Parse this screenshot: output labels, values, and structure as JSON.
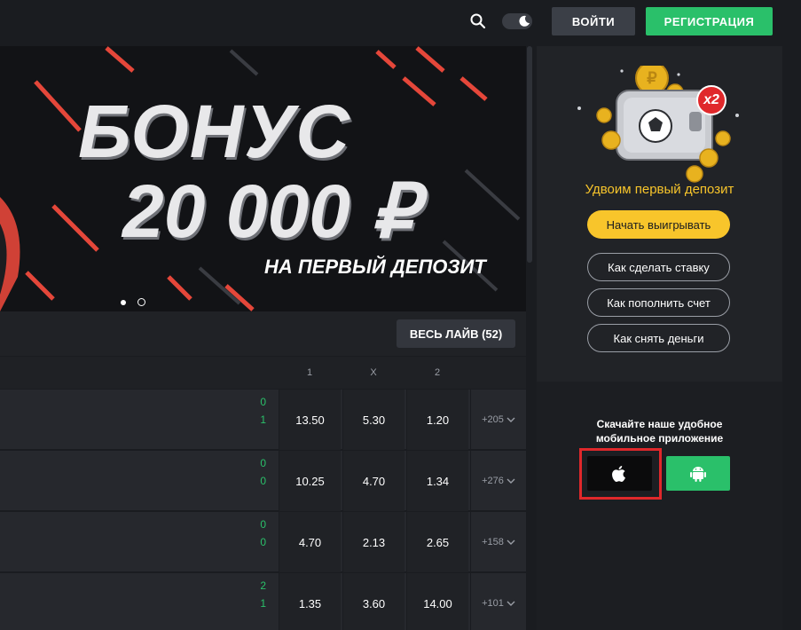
{
  "header": {
    "login_label": "ВОЙТИ",
    "register_label": "РЕГИСТРАЦИЯ"
  },
  "banner": {
    "title": "БОНУС",
    "amount": "20 000 ₽",
    "subtitle": "НА ПЕРВЫЙ ДЕПОЗИТ"
  },
  "live": {
    "all_live_label": "ВЕСЬ ЛАЙВ (52)"
  },
  "table": {
    "headers": [
      "1",
      "X",
      "2"
    ],
    "rows": [
      {
        "score_top": "0",
        "score_bottom": "1",
        "odds": [
          "13.50",
          "5.30",
          "1.20"
        ],
        "more": "+205"
      },
      {
        "score_top": "0",
        "score_bottom": "0",
        "odds": [
          "10.25",
          "4.70",
          "1.34"
        ],
        "more": "+276"
      },
      {
        "score_top": "0",
        "score_bottom": "0",
        "odds": [
          "4.70",
          "2.13",
          "2.65"
        ],
        "more": "+158"
      },
      {
        "score_top": "2",
        "score_bottom": "1",
        "odds": [
          "1.35",
          "3.60",
          "14.00"
        ],
        "more": "+101"
      }
    ]
  },
  "sidebar": {
    "promo_text": "Удвоим первый депозит",
    "badge": "x2",
    "start_label": "Начать выигрывать",
    "links": [
      "Как сделать ставку",
      "Как пополнить счет",
      "Как снять деньги"
    ],
    "app_text_line1": "Скачайте наше удобное",
    "app_text_line2": "мобильное приложение"
  },
  "colors": {
    "accent_green": "#2ac06a",
    "accent_yellow": "#f8c52b",
    "highlight_red": "#e0282b"
  }
}
